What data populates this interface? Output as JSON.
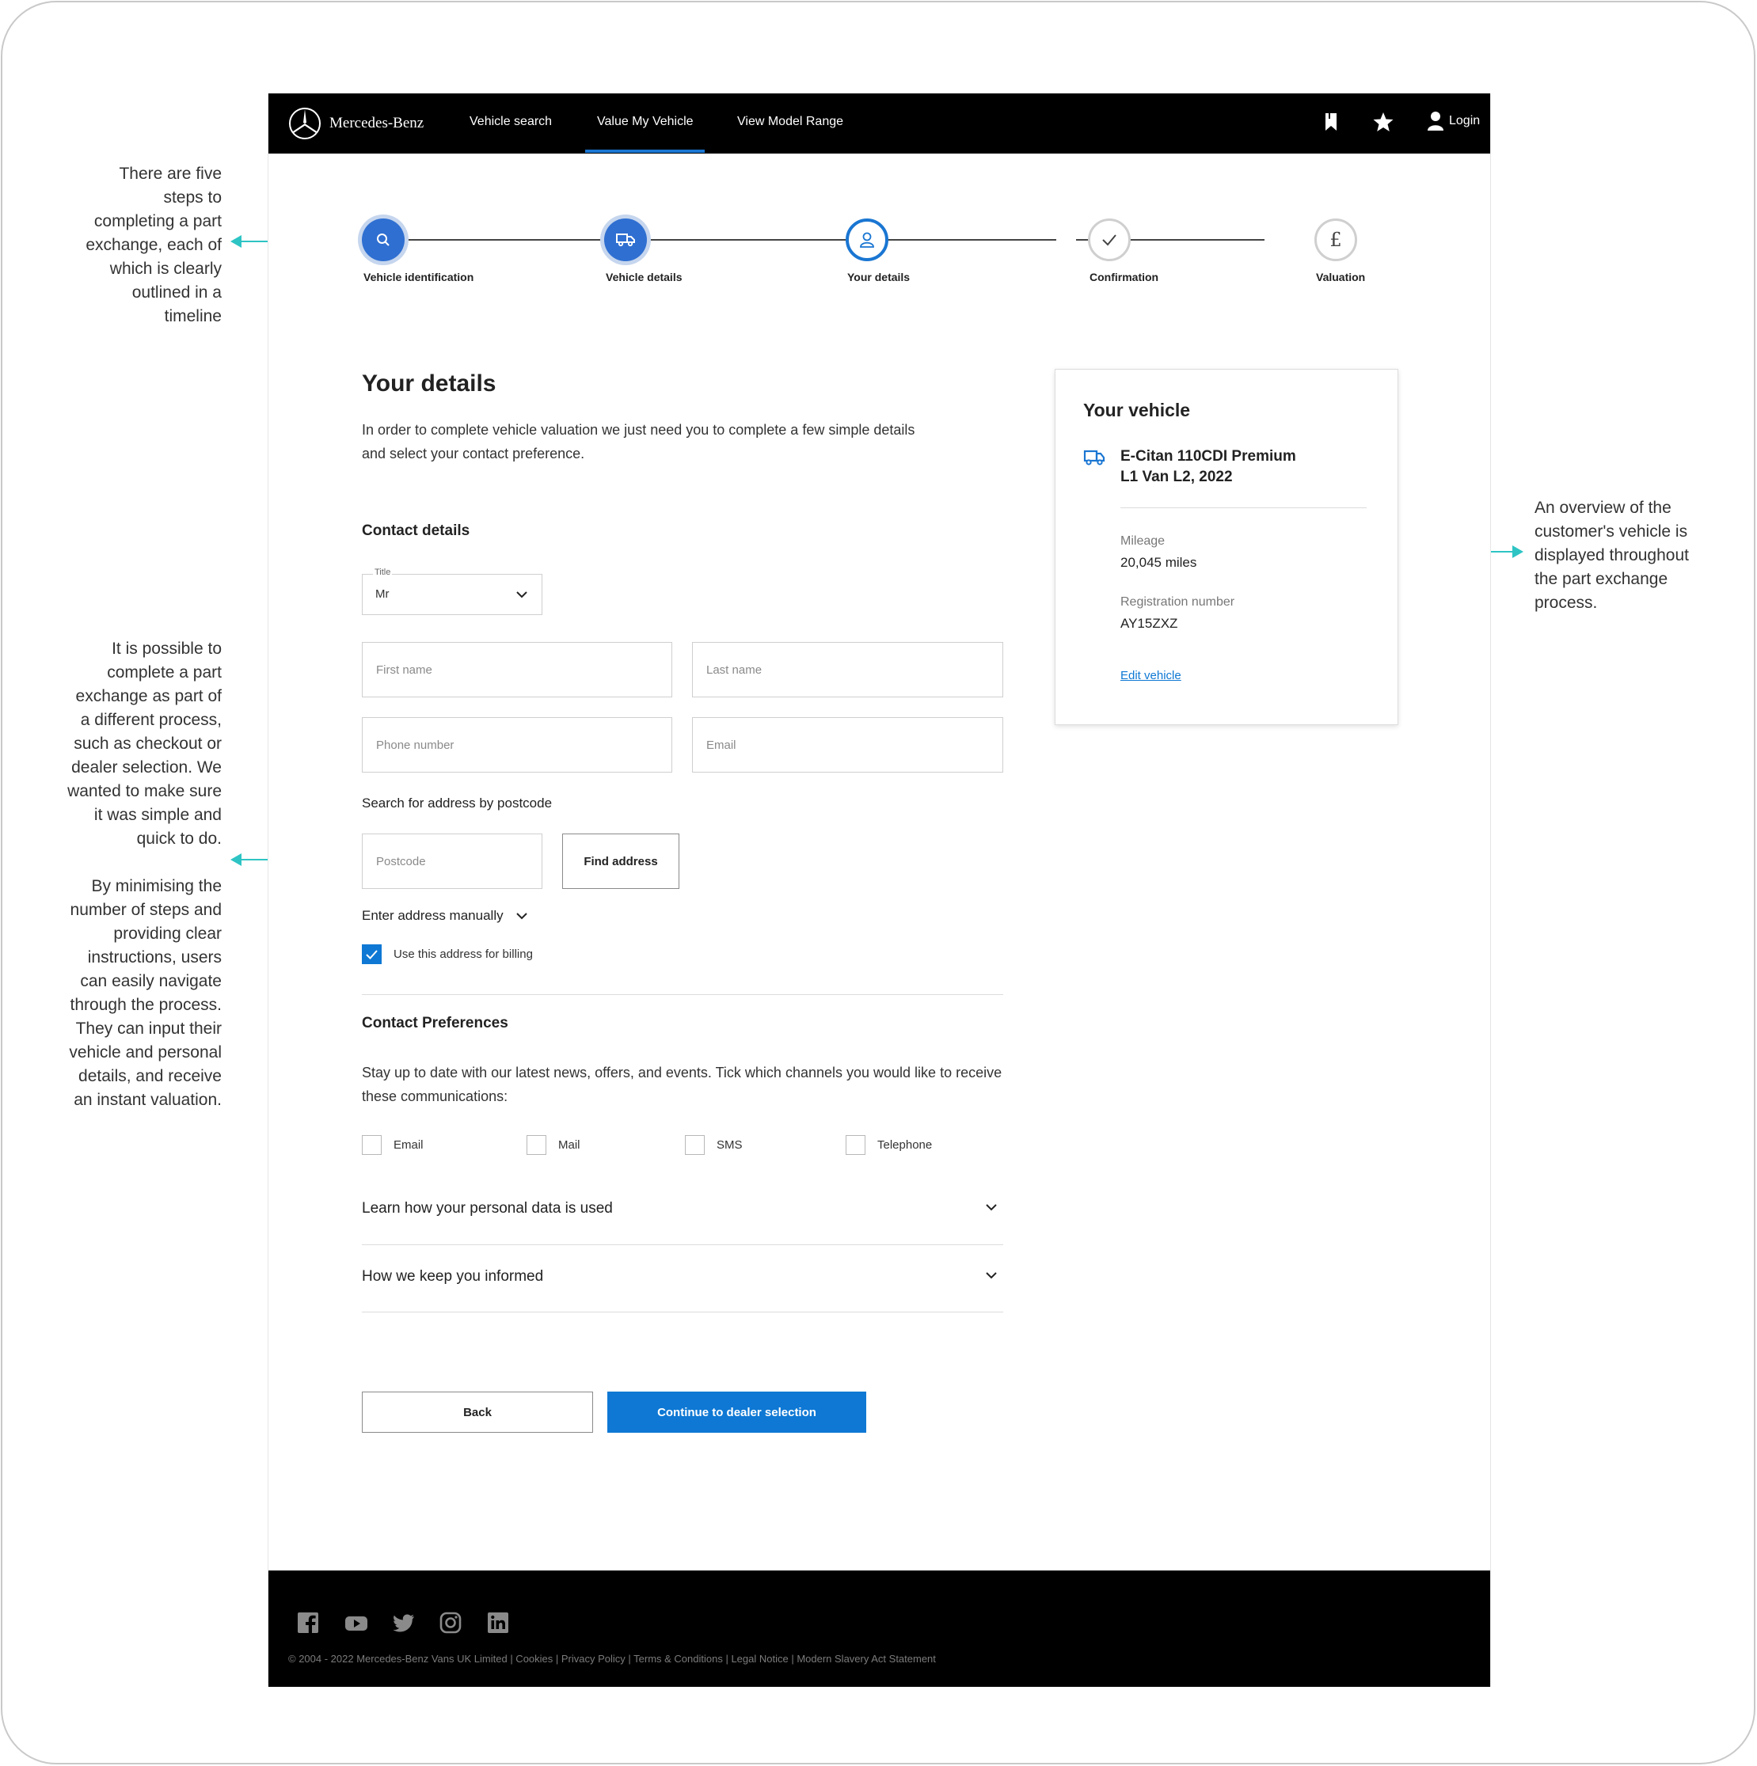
{
  "annotations": {
    "timeline": [
      "There are five",
      "steps to",
      "completing a part",
      "exchange, each of",
      "which is clearly",
      "outlined in a",
      "timeline"
    ],
    "process_p1": [
      "It is possible to",
      "complete a part",
      "exchange as part of",
      "a different process,",
      "such as checkout or",
      "dealer selection. We",
      "wanted to make sure",
      "it was simple and",
      "quick to do."
    ],
    "process_p2": [
      "By minimising the",
      "number of steps and",
      "providing clear",
      "instructions, users",
      "can easily navigate",
      "through the process.",
      "They can input their",
      "vehicle and personal",
      "details, and receive",
      "an instant valuation."
    ],
    "overview": [
      "An overview of the",
      "customer's vehicle is",
      "displayed throughout",
      "the part exchange",
      "process."
    ]
  },
  "nav": {
    "brand": "Mercedes-Benz",
    "links": [
      "Vehicle search",
      "Value My Vehicle",
      "View Model Range"
    ],
    "active_link": "Value My Vehicle",
    "login": "Login"
  },
  "steps": [
    {
      "label": "Vehicle identification",
      "state": "done",
      "icon": "search-icon"
    },
    {
      "label": "Vehicle details",
      "state": "done",
      "icon": "truck-icon"
    },
    {
      "label": "Your details",
      "state": "current",
      "icon": "user-icon"
    },
    {
      "label": "Confirmation",
      "state": "todo",
      "icon": "check-icon"
    },
    {
      "label": "Valuation",
      "state": "todo",
      "icon": "pound-icon"
    }
  ],
  "form": {
    "title": "Your details",
    "intro": "In order to complete vehicle valuation we just need you to complete a few simple details and select your contact preference.",
    "contact_heading": "Contact details",
    "title_label": "Title",
    "title_value": "Mr",
    "first_name_placeholder": "First name",
    "last_name_placeholder": "Last name",
    "phone_placeholder": "Phone number",
    "email_placeholder": "Email",
    "postcode_heading": "Search for address by postcode",
    "postcode_placeholder": "Postcode",
    "find_address": "Find address",
    "manual_address": "Enter address manually",
    "billing_label": "Use this address for billing",
    "billing_checked": true,
    "prefs_heading": "Contact Preferences",
    "prefs_text": "Stay up to date with our latest news, offers, and events. Tick which channels you would like to receive these communications:",
    "channels": [
      "Email",
      "Mail",
      "SMS",
      "Telephone"
    ],
    "accordions": [
      "Learn how your personal data is used",
      "How we keep you informed"
    ],
    "back": "Back",
    "continue": "Continue to dealer selection"
  },
  "vehicle": {
    "heading": "Your vehicle",
    "name_line1": "E-Citan 110CDI Premium",
    "name_line2": "L1 Van L2, 2022",
    "mileage_label": "Mileage",
    "mileage_value": "20,045 miles",
    "reg_label": "Registration number",
    "reg_value": "AY15ZXZ",
    "edit": "Edit vehicle"
  },
  "footer": {
    "social": [
      "facebook-icon",
      "youtube-icon",
      "twitter-icon",
      "instagram-icon",
      "linkedin-icon"
    ],
    "legal": "© 2004 - 2022 Mercedes-Benz Vans UK Limited  |  Cookies  |  Privacy Policy  |  Terms & Conditions  |  Legal Notice  |  Modern Slavery Act Statement"
  },
  "colors": {
    "accent": "#0e78d4",
    "annotation": "#2ec4c4",
    "nav_bg": "#000000",
    "step_done": "#2f6fd1"
  }
}
